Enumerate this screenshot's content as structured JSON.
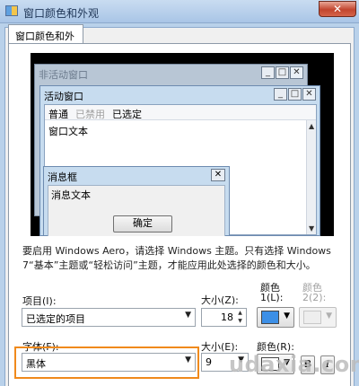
{
  "window": {
    "title": "窗口颜色和外观",
    "close_glyph": "✕"
  },
  "tabs": [
    {
      "label": "窗口颜色和外观"
    }
  ],
  "preview": {
    "inactive_window": {
      "title": "非活动窗口",
      "buttons": [
        "_",
        "□",
        "✕"
      ]
    },
    "active_window": {
      "title": "活动窗口",
      "buttons": [
        "_",
        "□",
        "✕"
      ],
      "menu": [
        "普通",
        "已禁用",
        "已选定"
      ],
      "text": "窗口文本"
    },
    "message_box": {
      "title": "消息框",
      "close": "✕",
      "text": "消息文本",
      "ok_label": "确定"
    }
  },
  "description": "要启用 Windows Aero，请选择 Windows 主题。只有选择 Windows 7“基本”主题或“轻松访问”主题，才能应用此处选择的颜色和大小。",
  "item": {
    "label": "项目(I):",
    "value": "已选定的项目",
    "size_label": "大小(Z):",
    "size_value": "18",
    "color1_label_line1": "颜色",
    "color1_label_line2": "1(L):",
    "color1_value": "#3c8fe6",
    "color2_label_line1": "颜色",
    "color2_label_line2": "2(2):"
  },
  "font": {
    "label": "字体(F):",
    "value": "黑体",
    "size_label": "大小(E):",
    "size_value": "9",
    "color_label": "颜色(R):",
    "color_value": "#ffffff",
    "bold_label": "B",
    "italic_label": "I"
  },
  "watermark": "udaxia.com"
}
